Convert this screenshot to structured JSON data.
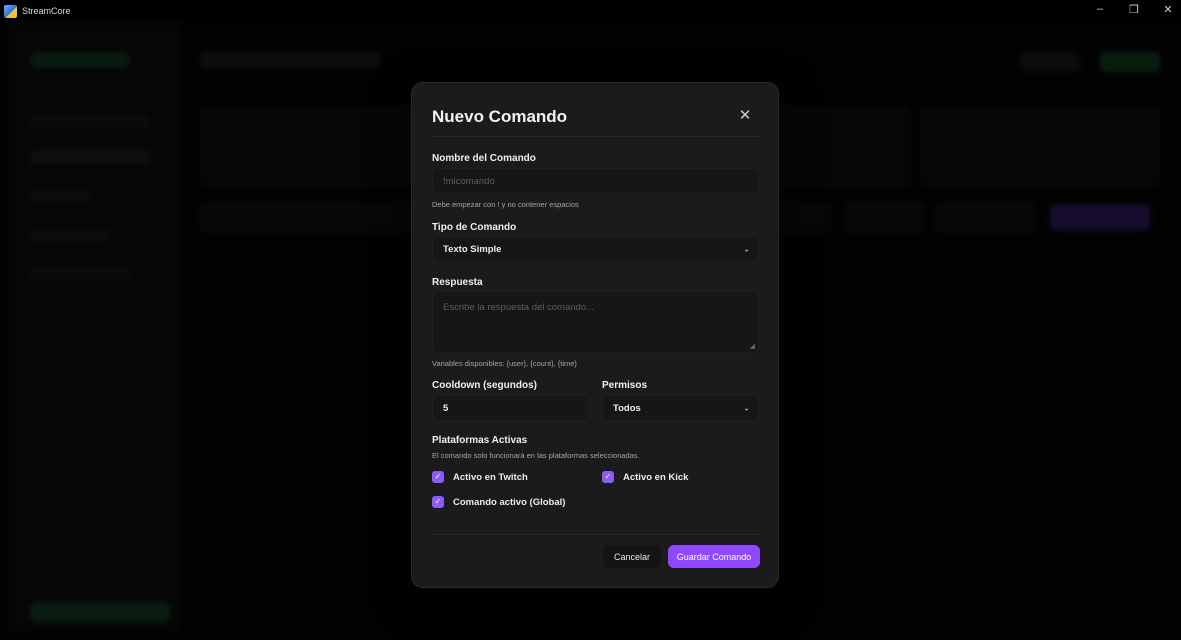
{
  "window": {
    "title": "StreamCore",
    "minimize": "–",
    "maximize": "❐",
    "close": "✕"
  },
  "modal": {
    "title": "Nuevo Comando",
    "close_icon": "✕",
    "name_field": {
      "label": "Nombre del Comando",
      "placeholder": "!micomando",
      "hint": "Debe empezar con ! y no contener espacios"
    },
    "type_field": {
      "label": "Tipo de Comando",
      "value": "Texto Simple"
    },
    "response_field": {
      "label": "Respuesta",
      "placeholder": "Escribe la respuesta del comando...",
      "hint": "Variables disponibles: {user}, {count}, {time}"
    },
    "cooldown_field": {
      "label": "Cooldown (segundos)",
      "value": "5"
    },
    "permissions_field": {
      "label": "Permisos",
      "value": "Todos"
    },
    "platforms": {
      "label": "Plataformas Activas",
      "hint": "El comando solo funcionará en las plataformas seleccionadas.",
      "twitch": "Activo en Twitch",
      "kick": "Activo en Kick",
      "global": "Comando activo (Global)",
      "twitch_checked": true,
      "kick_checked": true,
      "global_checked": true
    },
    "buttons": {
      "cancel": "Cancelar",
      "save": "Guardar Comando"
    }
  },
  "colors": {
    "accent": "#9147ff",
    "checkbox": "#8b5cf6",
    "modal_bg": "#1b1b1d",
    "input_bg": "#161618"
  },
  "icons": {
    "chevron": "chevron-down-icon",
    "check": "check-icon",
    "close": "close-icon"
  }
}
